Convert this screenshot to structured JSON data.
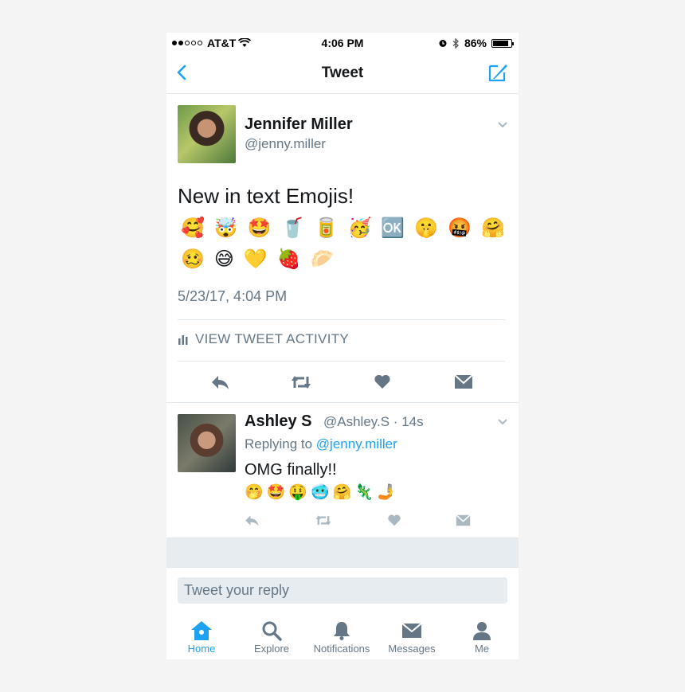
{
  "status_bar": {
    "carrier": "AT&T",
    "time": "4:06 PM",
    "battery": "86%",
    "battery_level": 0.86,
    "signal_bars": 2
  },
  "nav": {
    "title": "Tweet",
    "back_icon": "back-chevron-icon",
    "compose_icon": "compose-tweet-icon"
  },
  "tweet": {
    "author_name": "Jennifer Miller",
    "author_handle": "@jenny.miller",
    "text": "New in text Emojis!",
    "emoji_row1": [
      "🥰",
      "🤯",
      "🤩",
      "🥤",
      "🥫",
      "🥳",
      "🆗",
      "🤫",
      "🤬",
      "🤗"
    ],
    "emoji_row2": [
      "🥴",
      "😅",
      "💛",
      "🍓",
      "🥟"
    ],
    "timestamp": "5/23/17, 4:04 PM",
    "activity_label": "VIEW TWEET ACTIVITY",
    "actions": [
      "reply-icon",
      "retweet-icon",
      "like-icon",
      "direct-message-icon"
    ]
  },
  "reply": {
    "author_name": "Ashley S",
    "author_handle": "@Ashley.S · 14s",
    "replying_prefix": "Replying to",
    "replying_mention": "@jenny.miller",
    "text": "OMG finally!!",
    "emojis": [
      "🤭",
      "🤩",
      "🤑",
      "🥶",
      "🤗",
      "🦎",
      "🤳"
    ]
  },
  "reply_input": {
    "placeholder": "Tweet your reply"
  },
  "tabbar": {
    "tabs": [
      {
        "label": "Home",
        "icon": "home-icon",
        "active": true
      },
      {
        "label": "Explore",
        "icon": "search-icon",
        "active": false
      },
      {
        "label": "Notifications",
        "icon": "bell-icon",
        "active": false
      },
      {
        "label": "Messages",
        "icon": "envelope-icon",
        "active": false
      },
      {
        "label": "Me",
        "icon": "person-icon",
        "active": false
      }
    ]
  },
  "colors": {
    "accent": "#1da1f2",
    "secondary_text": "#657786",
    "divider": "#e1e8ed"
  }
}
